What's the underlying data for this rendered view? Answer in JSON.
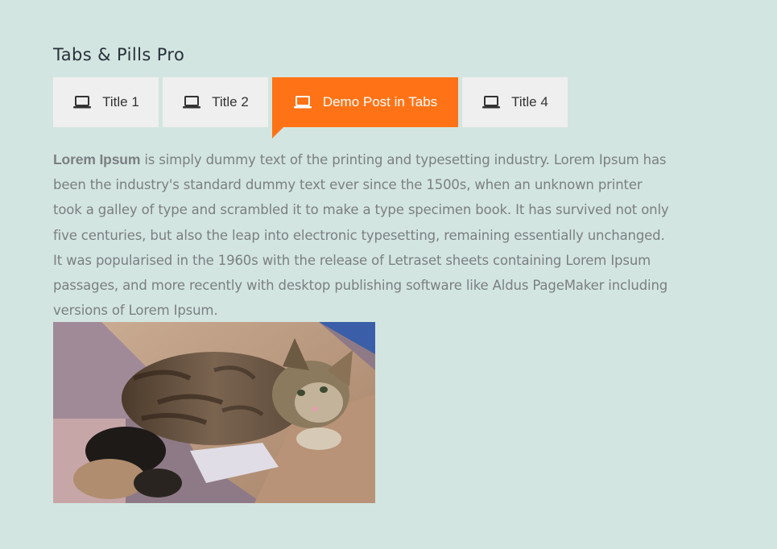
{
  "widget": {
    "title": "Tabs & Pills Pro"
  },
  "tabs": [
    {
      "label": "Title 1",
      "icon": "laptop-icon",
      "active": false
    },
    {
      "label": "Title 2",
      "icon": "laptop-icon",
      "active": false
    },
    {
      "label": "Demo Post in Tabs",
      "icon": "laptop-icon",
      "active": true
    },
    {
      "label": "Title 4",
      "icon": "laptop-icon",
      "active": false
    }
  ],
  "content": {
    "lead": "Lorem Ipsum",
    "body": " is simply dummy text of the printing and typesetting industry. Lorem Ipsum has been the industry's standard dummy text ever since the 1500s, when an unknown printer took a galley of type and scrambled it to make a type specimen book. It has survived not only five centuries, but also the leap into electronic typesetting, remaining essentially unchanged. It was popularised in the 1960s with the release of Letraset sheets containing Lorem Ipsum passages, and more recently with desktop publishing software like Aldus PageMaker including versions of Lorem Ipsum."
  },
  "colors": {
    "background": "#d3e5e0",
    "active_tab": "#ff7316",
    "inactive_tab": "#efefef",
    "title_text": "#27313b",
    "body_text": "#7a7f82"
  }
}
